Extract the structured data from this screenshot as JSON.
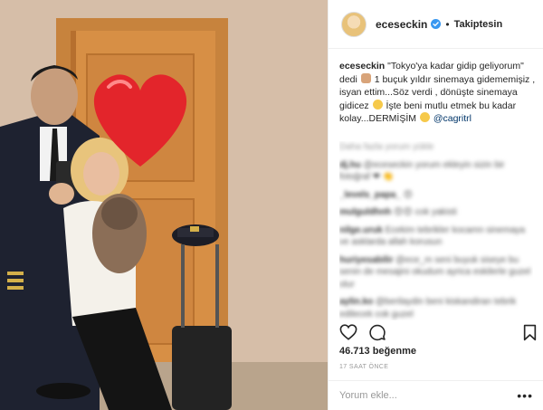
{
  "post": {
    "username": "eceseckin",
    "follow_label": "Takiptesin",
    "caption_user": "eceseckin",
    "caption_part1": "\"Tokyo'ya kadar gidip geliyorum\" dedi",
    "caption_part2": "1 buçuk yıldır sinemaya gidememişiz , isyan ettim...Söz verdi , dönüşte sinemaya gidicez",
    "caption_part3": "İşte beni mutlu etmek bu kadar kolay...DERMİŞİM",
    "caption_mention": "@cagritrl",
    "likes": "46.713 beğenme",
    "time": "17 SAAT ÖNCE",
    "comment_placeholder": "Yorum ekle...",
    "more_label": "•••"
  },
  "comments": [
    {
      "user": "",
      "text": "Daha fazla yorum yükle"
    },
    {
      "user": "dj.hu",
      "text": "@eceseckin yorum ekleyin sizin bir fotoğraf ❤ 👏"
    },
    {
      "user": "_levels_papa_",
      "text": "😍"
    },
    {
      "user": "mulguldhnh",
      "text": "😍😍 cok yakisti"
    },
    {
      "user": "nilge.uruk",
      "text": "Ecekim tebrikler kocamn sinemaya ve asklarda allah korusun"
    },
    {
      "user": "huriyesabilir",
      "text": "@ece_m seni buyuk siseye bu senin de mesajini okudum ayrica eskilerle guzel olur"
    },
    {
      "user": "aylin.ko",
      "text": "@berilaydin beni kiskandiran tebrik edilecek cok guzel"
    }
  ],
  "icons": {
    "heart": "heart-outline-icon",
    "comment": "comment-icon",
    "bookmark": "bookmark-icon",
    "verified": "verified-icon"
  },
  "colors": {
    "accent": "#3897f0",
    "text": "#262626",
    "muted": "#999999",
    "heart_sticker": "#e3252b"
  }
}
